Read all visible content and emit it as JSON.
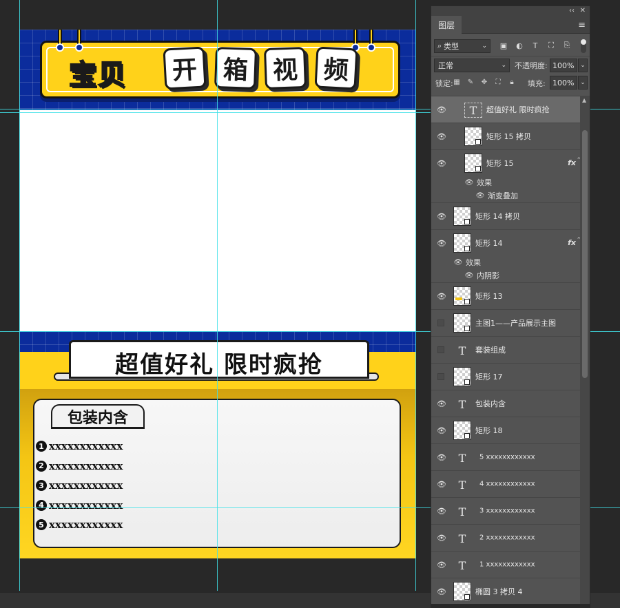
{
  "canvas": {
    "banner_chars": [
      "宝贝"
    ],
    "boxed_chars": [
      "开",
      "箱",
      "视",
      "频"
    ],
    "headline2": "超值好礼 限时疯抢",
    "package_title": "包装内含",
    "items": [
      {
        "num": "1",
        "text": "xxxxxxxxxxxx"
      },
      {
        "num": "2",
        "text": "xxxxxxxxxxxx"
      },
      {
        "num": "3",
        "text": "xxxxxxxxxxxx"
      },
      {
        "num": "4",
        "text": "xxxxxxxxxxxx"
      },
      {
        "num": "5",
        "text": "xxxxxxxxxxxx"
      }
    ],
    "colors": {
      "blue": "#0b2c9c",
      "yellow": "#ffd21a",
      "guide": "#3fe0e8"
    }
  },
  "panel": {
    "collapse": "‹‹",
    "close": "✕",
    "tab": "图层",
    "menu": "≡",
    "filter": {
      "kind": "类型",
      "icons": [
        "image-filter-icon",
        "adjustment-filter-icon",
        "type-filter-icon",
        "shape-filter-icon",
        "smart-object-filter-icon"
      ]
    },
    "blend_mode": "正常",
    "opacity_label": "不透明度:",
    "opacity_value": "100%",
    "lock_label": "锁定:",
    "fill_label": "填充:",
    "fill_value": "100%",
    "layers": [
      {
        "name": "超值好礼 限时疯抢",
        "kind": "text",
        "selected": true,
        "visible": true,
        "indent": true
      },
      {
        "name": "矩形 15 拷贝",
        "kind": "shape",
        "visible": true,
        "indent": true
      },
      {
        "name": "矩形 15",
        "kind": "shape",
        "visible": true,
        "indent": true,
        "fx": true
      },
      {
        "name": "效果",
        "kind": "effects-header",
        "visible": true,
        "sub": true,
        "subindent": 1
      },
      {
        "name": "渐变叠加",
        "kind": "effect",
        "visible": true,
        "sub": true,
        "subindent": 2
      },
      {
        "name": "矩形 14 拷贝",
        "kind": "shape",
        "visible": true
      },
      {
        "name": "矩形 14",
        "kind": "shape",
        "visible": true,
        "fx": true
      },
      {
        "name": "效果",
        "kind": "effects-header",
        "visible": true,
        "sub": true,
        "subindent": 0
      },
      {
        "name": "内阴影",
        "kind": "effect",
        "visible": true,
        "sub": true,
        "subindent": 1
      },
      {
        "name": "矩形 13",
        "kind": "shape",
        "visible": true,
        "yellow": true
      },
      {
        "name": "主图1——产品展示主图",
        "kind": "shape",
        "visible": false
      },
      {
        "name": "套装组成",
        "kind": "text",
        "visible": false
      },
      {
        "name": "矩形 17",
        "kind": "shape",
        "visible": false
      },
      {
        "name": "包装内含",
        "kind": "text",
        "visible": true
      },
      {
        "name": "矩形 18",
        "kind": "shape",
        "visible": true
      },
      {
        "name": "5 xxxxxxxxxxxx",
        "kind": "text",
        "visible": true,
        "small": true
      },
      {
        "name": "4 xxxxxxxxxxxx",
        "kind": "text",
        "visible": true,
        "small": true
      },
      {
        "name": "3 xxxxxxxxxxxx",
        "kind": "text",
        "visible": true,
        "small": true
      },
      {
        "name": "2 xxxxxxxxxxxx",
        "kind": "text",
        "visible": true,
        "small": true
      },
      {
        "name": "1 xxxxxxxxxxxx",
        "kind": "text",
        "visible": true,
        "small": true
      },
      {
        "name": "椭圆 3 拷贝 4",
        "kind": "shape",
        "visible": true
      }
    ]
  }
}
